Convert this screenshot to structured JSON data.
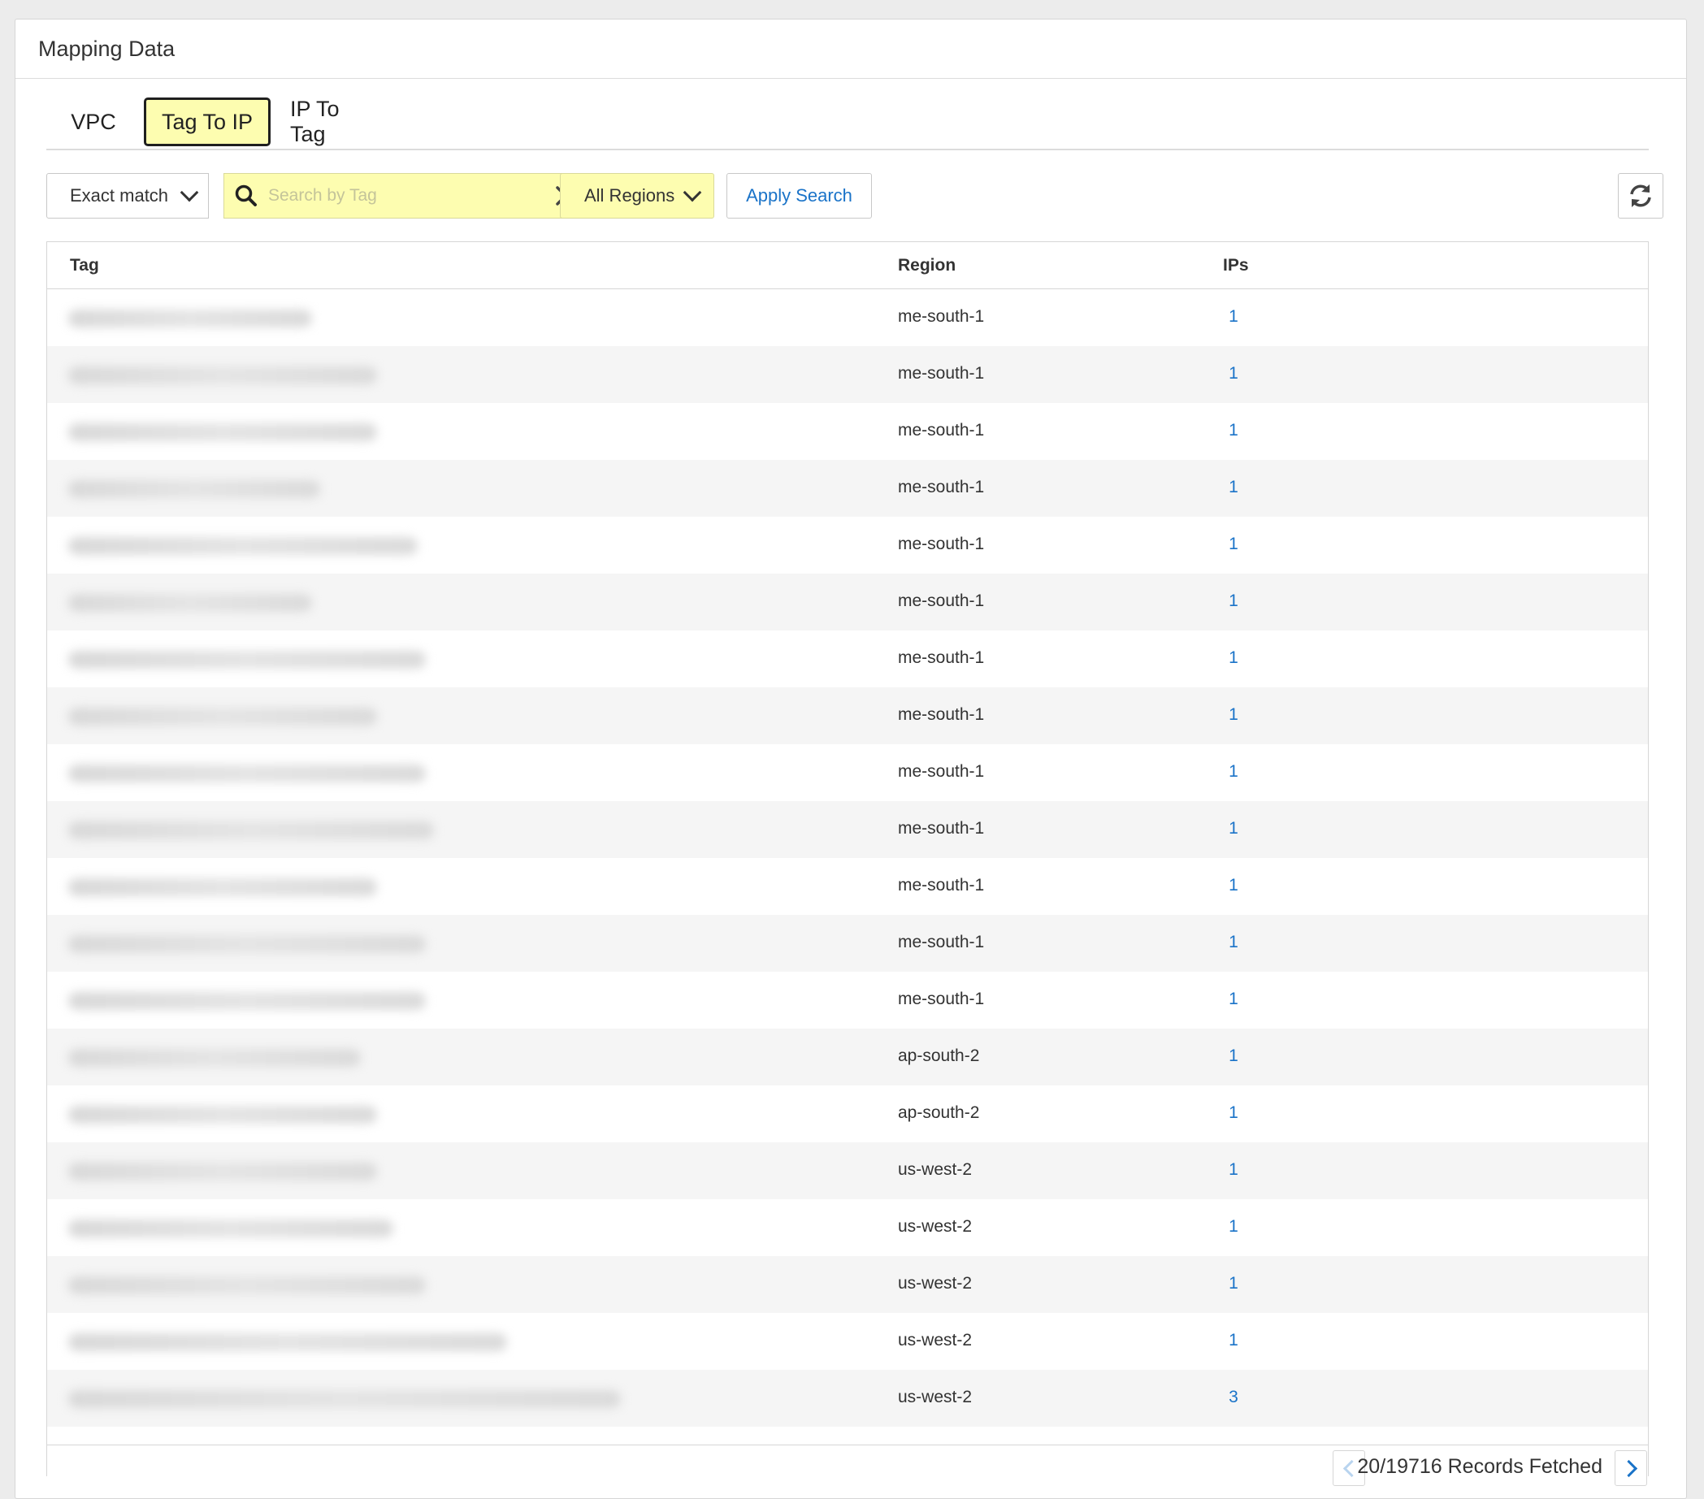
{
  "panel": {
    "title": "Mapping Data"
  },
  "tabs": [
    {
      "label": "VPC",
      "active": false
    },
    {
      "label": "Tag To IP",
      "active": true
    },
    {
      "label": "IP To Tag",
      "active": false
    }
  ],
  "toolbar": {
    "match_mode": "Exact match",
    "search_placeholder": "Search by Tag",
    "region_filter": "All Regions",
    "apply_label": "Apply Search"
  },
  "table": {
    "columns": {
      "tag": "Tag",
      "region": "Region",
      "ips": "IPs"
    },
    "rows": [
      {
        "region": "me-south-1",
        "ips": "1"
      },
      {
        "region": "me-south-1",
        "ips": "1"
      },
      {
        "region": "me-south-1",
        "ips": "1"
      },
      {
        "region": "me-south-1",
        "ips": "1"
      },
      {
        "region": "me-south-1",
        "ips": "1"
      },
      {
        "region": "me-south-1",
        "ips": "1"
      },
      {
        "region": "me-south-1",
        "ips": "1"
      },
      {
        "region": "me-south-1",
        "ips": "1"
      },
      {
        "region": "me-south-1",
        "ips": "1"
      },
      {
        "region": "me-south-1",
        "ips": "1"
      },
      {
        "region": "me-south-1",
        "ips": "1"
      },
      {
        "region": "me-south-1",
        "ips": "1"
      },
      {
        "region": "me-south-1",
        "ips": "1"
      },
      {
        "region": "ap-south-2",
        "ips": "1"
      },
      {
        "region": "ap-south-2",
        "ips": "1"
      },
      {
        "region": "us-west-2",
        "ips": "1"
      },
      {
        "region": "us-west-2",
        "ips": "1"
      },
      {
        "region": "us-west-2",
        "ips": "1"
      },
      {
        "region": "us-west-2",
        "ips": "1"
      },
      {
        "region": "us-west-2",
        "ips": "3"
      }
    ]
  },
  "footer": {
    "records_text": "20/19716 Records Fetched"
  },
  "colors": {
    "highlight": "#fdfdb0",
    "link": "#1a73c8",
    "row_alt": "#f5f5f5"
  }
}
